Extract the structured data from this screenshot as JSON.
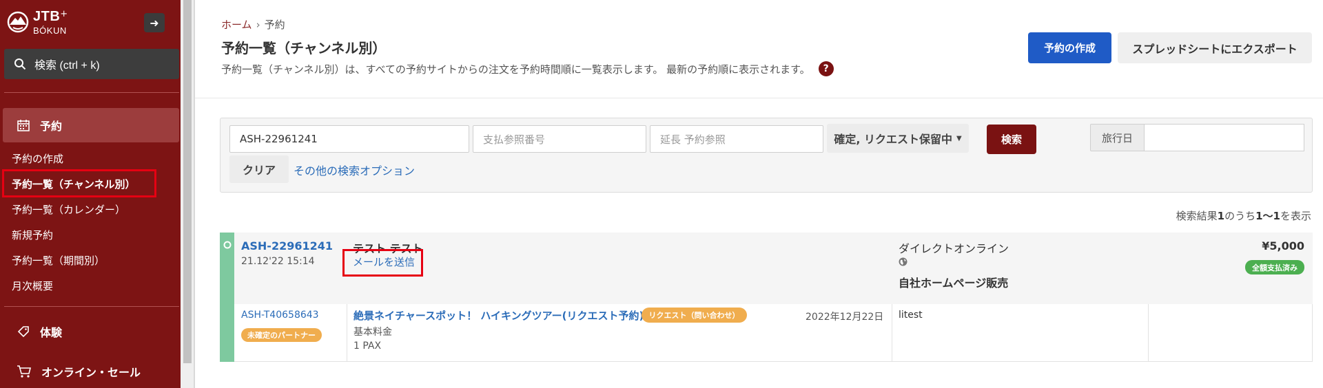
{
  "sidebar": {
    "logo_main": "JTB",
    "logo_plus": "+",
    "logo_sub": "BÓKUN",
    "search_label": "検索 (ctrl + k)",
    "section_bookings": "予約",
    "links": [
      "予約の作成",
      "予約一覧（チャンネル別）",
      "予約一覧（カレンダー）",
      "新規予約",
      "予約一覧（期間別）",
      "月次概要"
    ],
    "section_experiences": "体験",
    "section_online_sales": "オンライン・セール"
  },
  "header": {
    "breadcrumb_home": "ホーム",
    "breadcrumb_sep": "›",
    "breadcrumb_current": "予約",
    "title": "予約一覧（チャンネル別）",
    "description": "予約一覧（チャンネル別）は、すべての予約サイトからの注文を予約時間順に一覧表示します。 最新の予約順に表示されます。",
    "help": "?",
    "create_button": "予約の作成",
    "export_button": "スプレッドシートにエクスポート"
  },
  "filters": {
    "booking_ref_value": "ASH-22961241",
    "payment_ref_placeholder": "支払参照番号",
    "extension_ref_placeholder": "延長 予約参照",
    "status_dropdown": "確定, リクエスト保留中",
    "search_button": "検索",
    "travel_date_label": "旅行日",
    "clear_button": "クリア",
    "more_options": "その他の検索オプション"
  },
  "results": {
    "prefix": "検索結果",
    "total": "1",
    "mid": "のうち",
    "range": "1〜1",
    "suffix": "を表示"
  },
  "booking": {
    "id": "ASH-22961241",
    "created": "21.12'22 15:14",
    "customer": "テスト テスト",
    "send_mail": "メールを送信",
    "channel": "ダイレクトオンライン",
    "seller": "自社ホームページ販売",
    "price": "¥5,000",
    "payment_status": "全額支払済み",
    "product": {
      "id": "ASH-T40658643",
      "partner_badge": "未確定のパートナー",
      "title": "絶景ネイチャースポット！ ハイキングツアー(リクエスト予約)",
      "request_badge": "リクエスト（問い合わせ）",
      "date": "2022年12月22日",
      "rate": "基本料金",
      "pax": "1 PAX",
      "extra": "litest"
    }
  },
  "colors": {
    "sidebar_bg": "#7d1414",
    "primary_blue": "#1f5bc6",
    "search_red": "#7a1212",
    "link_blue": "#2b6cb8",
    "status_green": "#7ec99f",
    "badge_orange": "#f0ad4e",
    "highlight_red": "#e60012"
  }
}
